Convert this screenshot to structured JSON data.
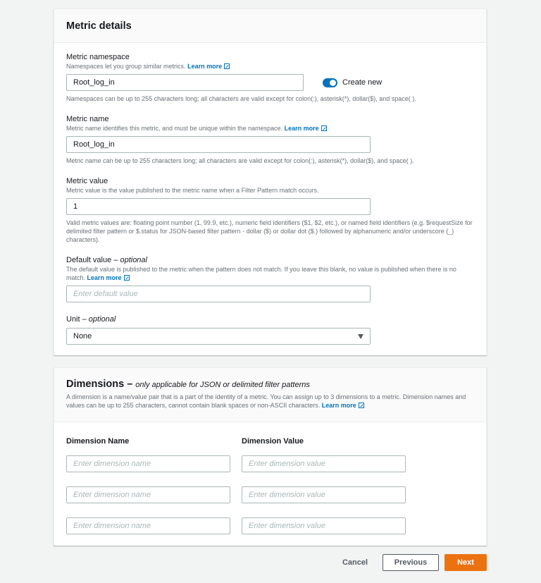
{
  "metric_details": {
    "title": "Metric details",
    "namespace": {
      "label": "Metric namespace",
      "description": "Namespaces let you group similar metrics.",
      "learn_more": "Learn more",
      "value": "Root_log_in",
      "toggle_label": "Create new",
      "toggle_on": true,
      "constraint": "Namespaces can be up to 255 characters long; all characters are valid except for colon(:), asterisk(*), dollar($), and space( )."
    },
    "name": {
      "label": "Metric name",
      "description": "Metric name identifies this metric, and must be unique within the namespace.",
      "learn_more": "Learn more",
      "value": "Root_log_in",
      "constraint": "Metric name can be up to 255 characters long; all characters are valid except for colon(:), asterisk(*), dollar($), and space( )."
    },
    "value": {
      "label": "Metric value",
      "description": "Metric value is the value published to the metric name when a Filter Pattern match occurs.",
      "value": "1",
      "constraint": "Valid metric values are: floating point number (1, 99.9, etc.), numeric field identifiers ($1, $2, etc.), or named field identifiers (e.g. $requestSize for delimited filter pattern or $.status for JSON-based filter pattern - dollar ($) or dollar dot ($.) followed by alphanumeric and/or underscore (_) characters)."
    },
    "default_value": {
      "label": "Default value",
      "optional": "optional",
      "description": "The default value is published to the metric when the pattern does not match. If you leave this blank, no value is published when there is no match.",
      "learn_more": "Learn more",
      "placeholder": "Enter default value"
    },
    "unit": {
      "label": "Unit",
      "optional": "optional",
      "selected": "None"
    }
  },
  "dimensions": {
    "title": "Dimensions",
    "dash": "–",
    "subtitle": "only applicable for JSON or delimited filter patterns",
    "description": "A dimension is a name/value pair that is a part of the identity of a metric. You can assign up to 3 dimensions to a metric. Dimension names and values can be up to 255 characters, cannot contain blank spaces or non-ASCII characters.",
    "learn_more": "Learn more",
    "name_header": "Dimension Name",
    "value_header": "Dimension Value",
    "rows": [
      {
        "name_placeholder": "Enter dimension name",
        "value_placeholder": "Enter dimension value"
      },
      {
        "name_placeholder": "Enter dimension name",
        "value_placeholder": "Enter dimension value"
      },
      {
        "name_placeholder": "Enter dimension name",
        "value_placeholder": "Enter dimension value"
      }
    ]
  },
  "footer": {
    "cancel": "Cancel",
    "previous": "Previous",
    "next": "Next"
  },
  "colors": {
    "accent": "#0073bb",
    "primary_button": "#ec7211",
    "background": "#f2f3f3"
  }
}
